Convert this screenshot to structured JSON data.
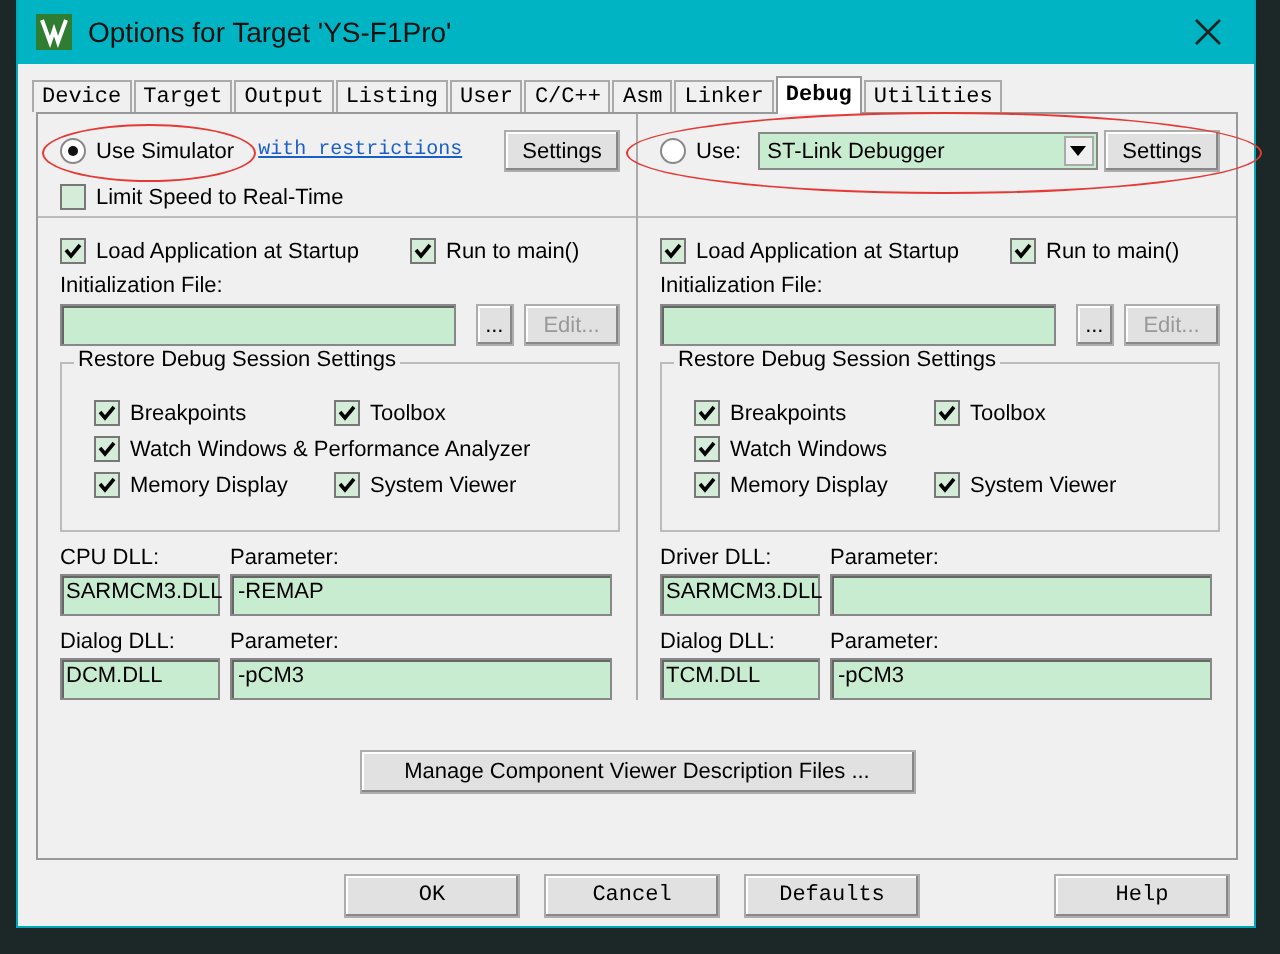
{
  "window": {
    "title": "Options for Target 'YS-F1Pro'"
  },
  "tabs": [
    {
      "label": "Device",
      "selected": false
    },
    {
      "label": "Target",
      "selected": false
    },
    {
      "label": "Output",
      "selected": false
    },
    {
      "label": "Listing",
      "selected": false
    },
    {
      "label": "User",
      "selected": false
    },
    {
      "label": "C/C++",
      "selected": false
    },
    {
      "label": "Asm",
      "selected": false
    },
    {
      "label": "Linker",
      "selected": false
    },
    {
      "label": "Debug",
      "selected": true
    },
    {
      "label": "Utilities",
      "selected": false
    }
  ],
  "panels": [
    {
      "kind": "simulator",
      "mode": {
        "label": "Use Simulator",
        "selected": true
      },
      "link": "with restrictions",
      "settings": "Settings",
      "limit_speed": {
        "label": "Limit Speed to Real-Time",
        "checked": false
      },
      "load_app": {
        "label": "Load Application at Startup",
        "checked": true
      },
      "run_to_main": {
        "label": "Run to main()",
        "checked": true
      },
      "init_label": "Initialization File:",
      "browse": "...",
      "edit": {
        "label": "Edit...",
        "disabled": true
      },
      "restore": {
        "title": "Restore Debug Session Settings",
        "items": [
          {
            "label": "Breakpoints",
            "checked": true
          },
          {
            "label": "Toolbox",
            "checked": true
          },
          {
            "label": "Watch Windows & Performance Analyzer",
            "checked": true
          },
          {
            "label": "Memory Display",
            "checked": true
          },
          {
            "label": "System Viewer",
            "checked": true
          }
        ]
      },
      "dlls": [
        {
          "label": "CPU DLL:",
          "value": "SARMCM3.DLL",
          "param_label": "Parameter:",
          "param": "-REMAP"
        },
        {
          "label": "Dialog DLL:",
          "value": "DCM.DLL",
          "param_label": "Parameter:",
          "param": "-pCM3"
        }
      ]
    },
    {
      "kind": "target",
      "mode": {
        "label": "Use:",
        "selected": false
      },
      "debugger": "ST-Link Debugger",
      "settings": "Settings",
      "load_app": {
        "label": "Load Application at Startup",
        "checked": true
      },
      "run_to_main": {
        "label": "Run to main()",
        "checked": true
      },
      "init_label": "Initialization File:",
      "browse": "...",
      "edit": {
        "label": "Edit...",
        "disabled": true
      },
      "restore": {
        "title": "Restore Debug Session Settings",
        "items": [
          {
            "label": "Breakpoints",
            "checked": true
          },
          {
            "label": "Toolbox",
            "checked": true
          },
          {
            "label": "Watch Windows",
            "checked": true
          },
          {
            "label": "Memory Display",
            "checked": true
          },
          {
            "label": "System Viewer",
            "checked": true
          }
        ]
      },
      "dlls": [
        {
          "label": "Driver DLL:",
          "value": "SARMCM3.DLL",
          "param_label": "Parameter:"
        },
        {
          "label": "Dialog DLL:",
          "value": "TCM.DLL",
          "param_label": "Parameter:",
          "param": "-pCM3"
        }
      ]
    }
  ],
  "manage_button": "Manage Component Viewer Description Files ...",
  "buttons": [
    "OK",
    "Cancel",
    "Defaults",
    "Help"
  ]
}
